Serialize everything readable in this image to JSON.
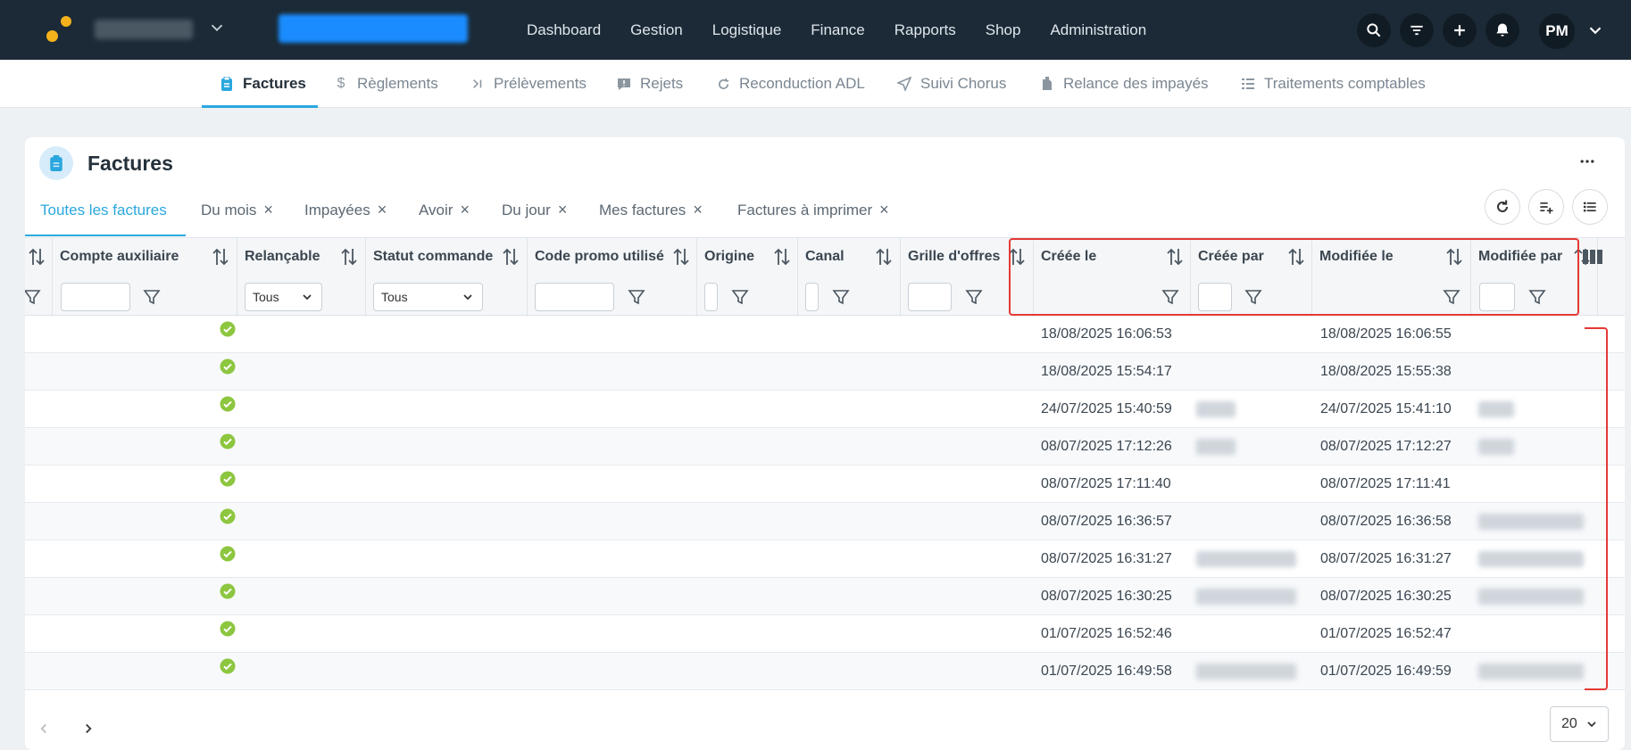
{
  "topbar": {
    "nav": [
      "Dashboard",
      "Gestion",
      "Logistique",
      "Finance",
      "Rapports",
      "Shop",
      "Administration"
    ],
    "user_initials": "PM",
    "icons": [
      "search-icon",
      "filter-icon",
      "plus-icon",
      "bell-icon"
    ]
  },
  "subnav": {
    "tabs": [
      {
        "label": "Factures",
        "icon": "clipboard-icon",
        "active": true
      },
      {
        "label": "Règlements",
        "icon": "dollar-icon"
      },
      {
        "label": "Prélèvements",
        "icon": "chevron-bar-icon"
      },
      {
        "label": "Rejets",
        "icon": "alert-square-icon"
      },
      {
        "label": "Reconduction ADL",
        "icon": "refresh-icon"
      },
      {
        "label": "Suivi Chorus",
        "icon": "send-icon"
      },
      {
        "label": "Relance des impayés",
        "icon": "file-icon"
      },
      {
        "label": "Traitements comptables",
        "icon": "list-icon"
      }
    ]
  },
  "card": {
    "title": "Factures",
    "views": [
      {
        "label": "Toutes les factures",
        "active": true,
        "closable": false
      },
      {
        "label": "Du mois",
        "closable": true
      },
      {
        "label": "Impayées",
        "closable": true
      },
      {
        "label": "Avoir",
        "closable": true
      },
      {
        "label": "Du jour",
        "closable": true
      },
      {
        "label": "Mes factures",
        "closable": true
      },
      {
        "label": "Factures à imprimer",
        "closable": true
      }
    ]
  },
  "table": {
    "columns": [
      {
        "label": "Compte auxiliaire"
      },
      {
        "label": "Relançable",
        "filter_value": "Tous"
      },
      {
        "label": "Statut commande",
        "filter_value": "Tous"
      },
      {
        "label": "Code promo utilisé"
      },
      {
        "label": "Origine"
      },
      {
        "label": "Canal"
      },
      {
        "label": "Grille d'offres"
      },
      {
        "label": "Créée le"
      },
      {
        "label": "Créée par"
      },
      {
        "label": "Modifiée le"
      },
      {
        "label": "Modifiée par"
      }
    ],
    "rows": [
      {
        "relancable": true,
        "creee_le": "18/08/2025 16:06:53",
        "modifiee_le": "18/08/2025 16:06:55"
      },
      {
        "relancable": true,
        "creee_le": "18/08/2025 15:54:17",
        "modifiee_le": "18/08/2025 15:55:38"
      },
      {
        "relancable": true,
        "creee_le": "24/07/2025 15:40:59",
        "modifiee_le": "24/07/2025 15:41:10"
      },
      {
        "relancable": true,
        "creee_le": "08/07/2025 17:12:26",
        "modifiee_le": "08/07/2025 17:12:27"
      },
      {
        "relancable": true,
        "creee_le": "08/07/2025 17:11:40",
        "modifiee_le": "08/07/2025 17:11:41"
      },
      {
        "relancable": true,
        "creee_le": "08/07/2025 16:36:57",
        "modifiee_le": "08/07/2025 16:36:58"
      },
      {
        "relancable": true,
        "creee_le": "08/07/2025 16:31:27",
        "modifiee_le": "08/07/2025 16:31:27"
      },
      {
        "relancable": true,
        "creee_le": "08/07/2025 16:30:25",
        "modifiee_le": "08/07/2025 16:30:25"
      },
      {
        "relancable": true,
        "creee_le": "01/07/2025 16:52:46",
        "modifiee_le": "01/07/2025 16:52:47"
      },
      {
        "relancable": true,
        "creee_le": "01/07/2025 16:49:58",
        "modifiee_le": "01/07/2025 16:49:59"
      }
    ]
  },
  "pagination": {
    "per_page": "20"
  },
  "colors": {
    "accent": "#2aa7de",
    "topbar": "#1b2a36",
    "check": "#8dc63f",
    "highlight": "#e53935"
  }
}
